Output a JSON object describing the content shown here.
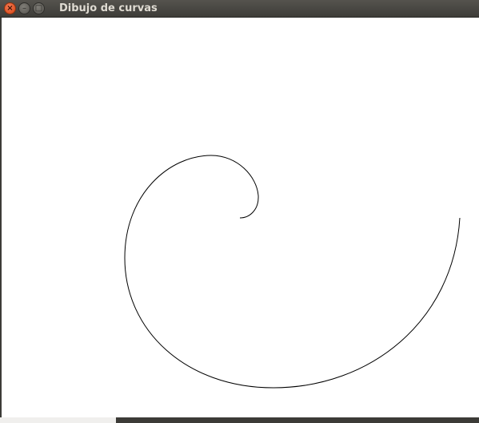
{
  "window": {
    "title": "Dibujo de curvas",
    "controls": {
      "close_icon": "close-icon",
      "minimize_icon": "minimize-icon",
      "maximize_icon": "maximize-icon"
    }
  },
  "canvas": {
    "background": "#ffffff",
    "stroke_color": "#000000",
    "curve": "spiral"
  },
  "colors": {
    "titlebar": "#3c3b37",
    "close": "#e0552a",
    "title_text": "#dfdbd2"
  }
}
